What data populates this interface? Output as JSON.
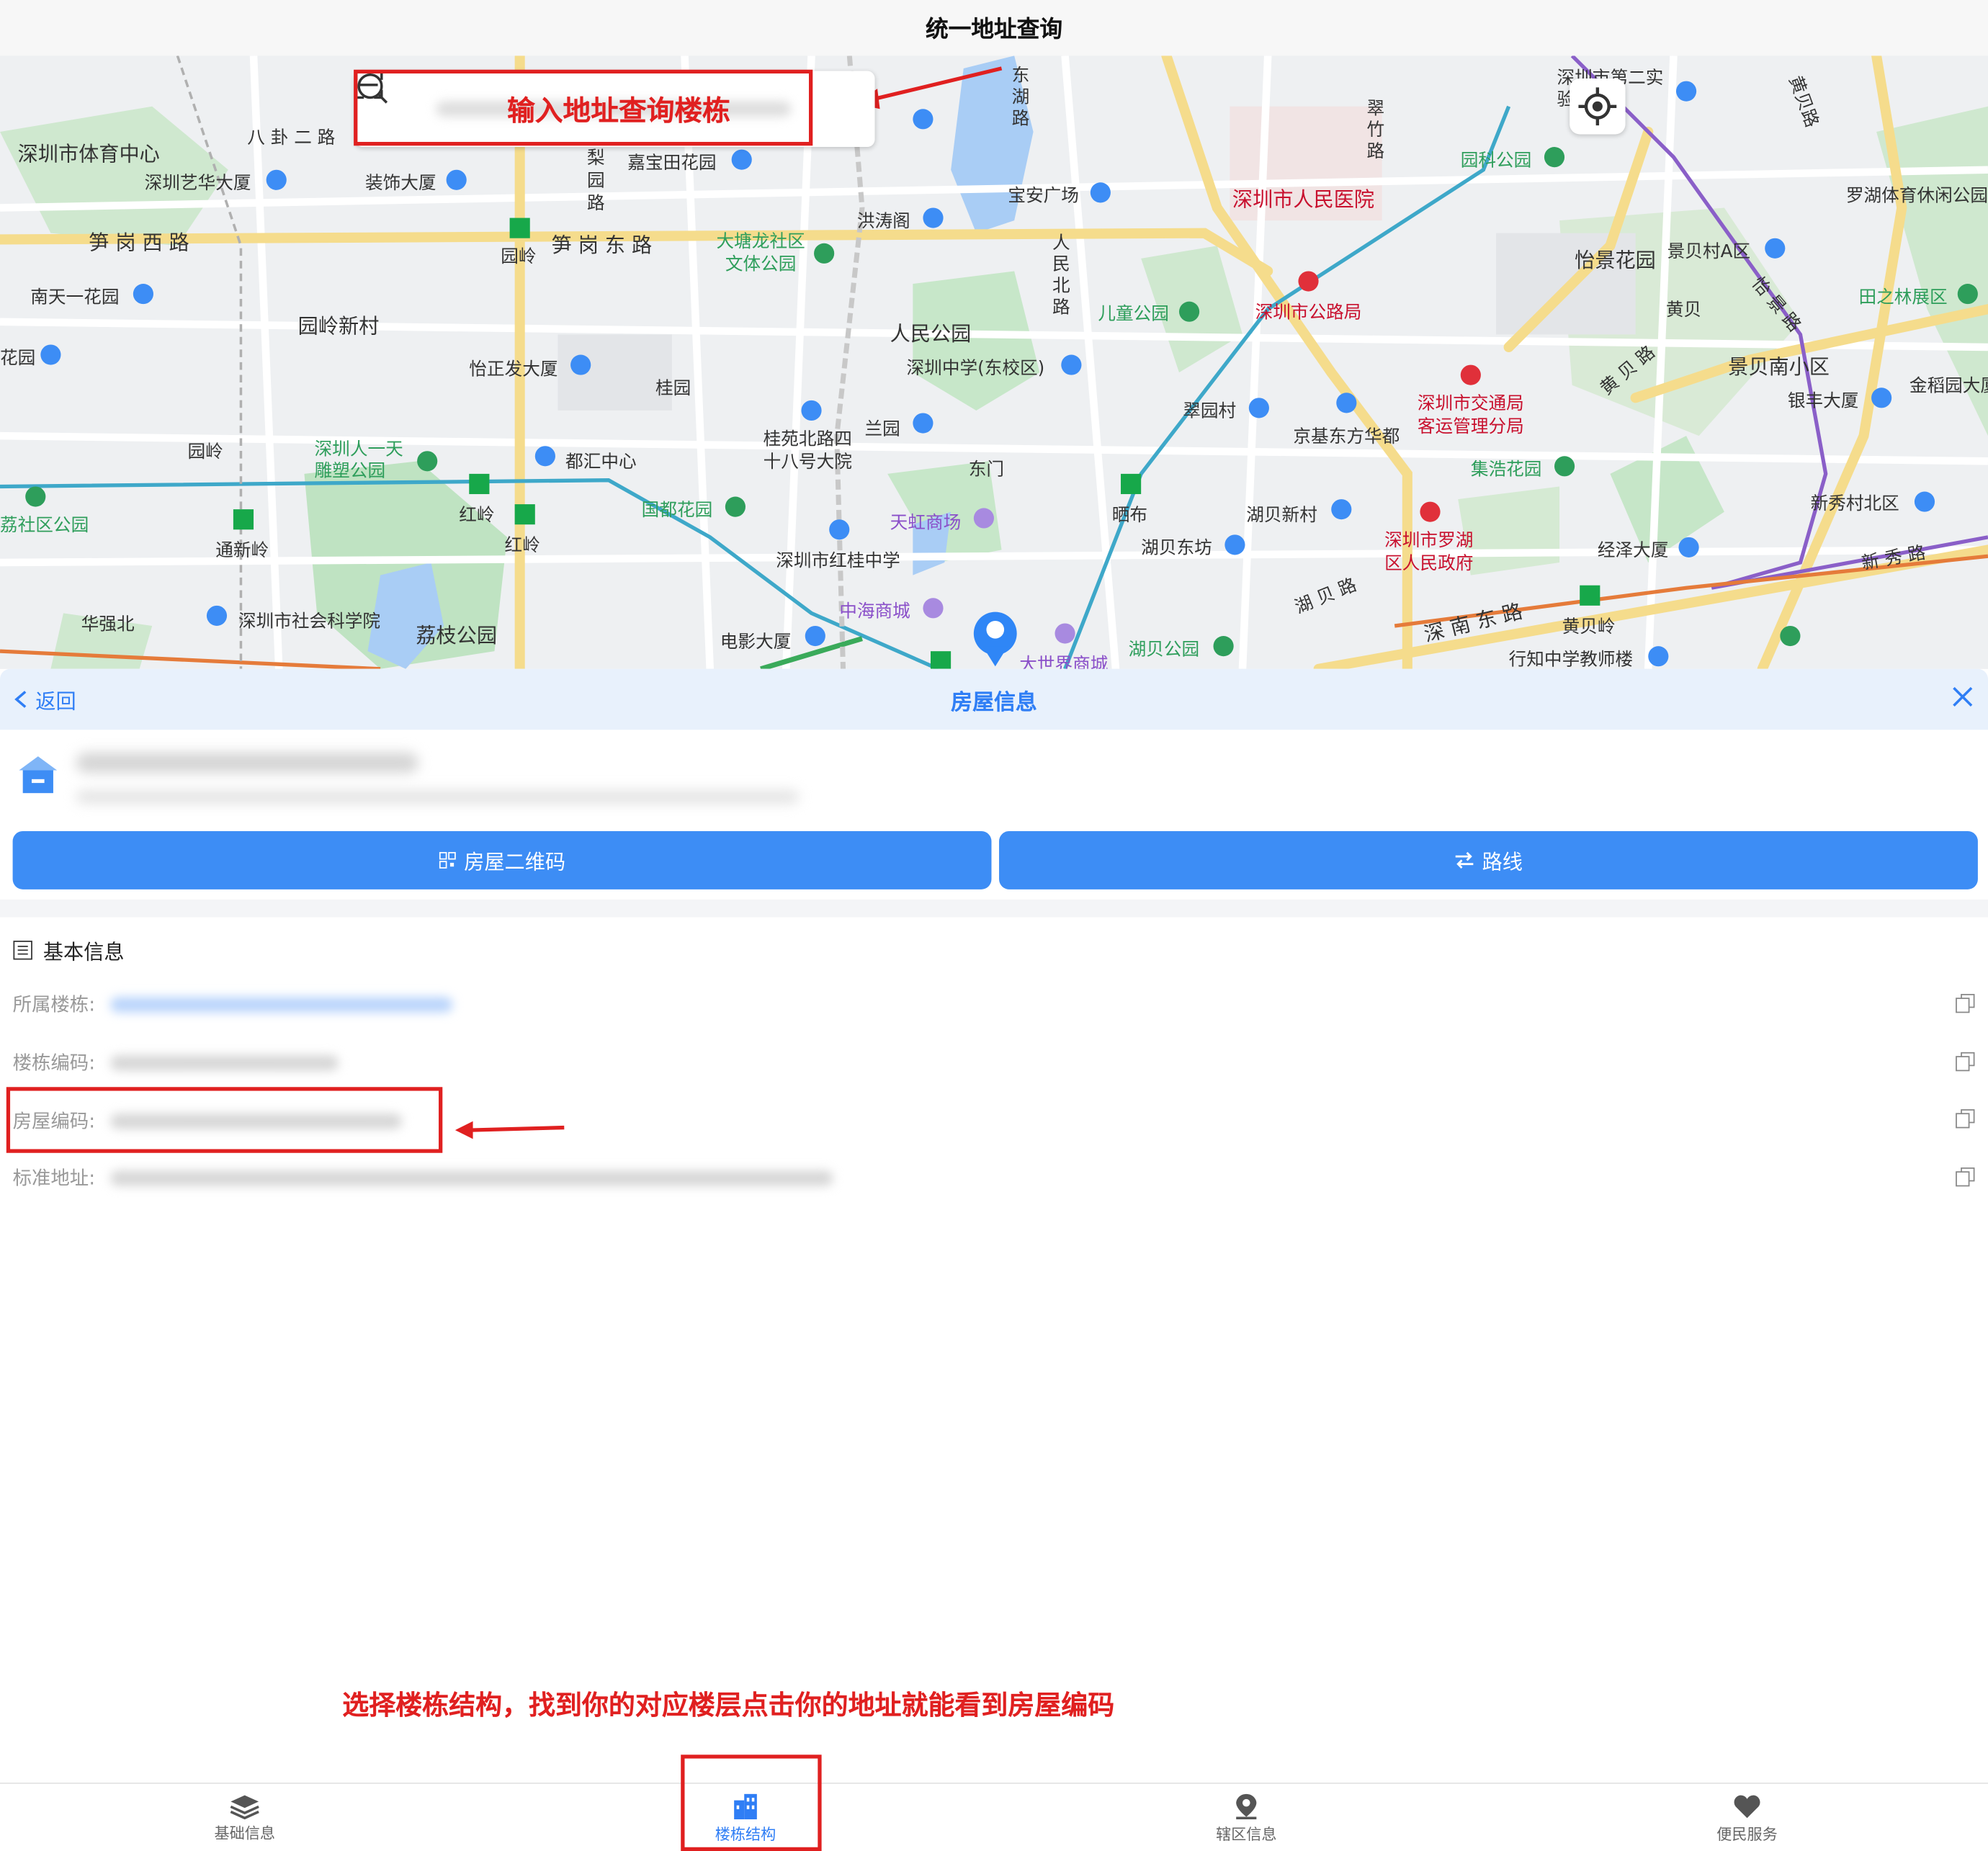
{
  "title": "统一地址查询",
  "map": {
    "search_hint": "输入地址查询楼栋",
    "labels": {
      "l1": "深圳市体育中心",
      "l2": "八 卦 二 路",
      "l3": "深圳艺华大厦",
      "l4": "装饰大厦",
      "l5": "梨园路",
      "l6": "嘉宝田花园",
      "l7": "笋 岗 西 路",
      "l8": "笋 岗 东 路",
      "l9": "园岭",
      "l10": "南天一花园",
      "l11": "园岭新村",
      "l12": "怡正发大厦",
      "l13": "桂园",
      "l14": "园岭",
      "l15": "深圳人一天雕塑公园",
      "l16": "都汇中心",
      "l17": "红岭",
      "l18": "红岭",
      "l19": "荔社区公园",
      "l20": "通新岭",
      "l21": "华强北",
      "l22": "深圳市社会科学院",
      "l23": "荔枝公园",
      "l24": "国都花园",
      "l25": "大塘龙社区文体公园",
      "l26": "洪涛阁",
      "l27": "宝安广场",
      "l28": "人民公园",
      "l29": "深圳中学(东校区)",
      "l30": "桂苑北路四十八号大院",
      "l31": "兰园",
      "l32": "东门",
      "l33": "天虹商场",
      "l34": "深圳市红桂中学",
      "l35": "中海商城",
      "l36": "电影大厦",
      "l37": "大世界商城",
      "l38": "人民北路",
      "l39": "儿童公园",
      "l40": "深圳市人民医院",
      "l41": "深圳市公路局",
      "l42": "翠竹路",
      "l43": "园科公园",
      "l44": "翠园村",
      "l45": "京基东方华都",
      "l46": "晒布",
      "l47": "湖贝新村",
      "l48": "湖贝东坊",
      "l49": "深圳市交通局客运管理分局",
      "l50": "集浩花园",
      "l51": "深圳市罗湖区人民政府",
      "l52": "湖 贝 路",
      "l53": "湖贝公园",
      "l54": "深 南 东 路",
      "l55": "黄贝岭",
      "l56": "行知中学教师楼",
      "l57": "经泽大厦",
      "l58": "怡景花园",
      "l59": "景贝村A区",
      "l60": "黄贝",
      "l61": "黄 贝 路",
      "l62": "景贝南小区",
      "l63": "银丰大厦",
      "l64": "田之林展区",
      "l65": "罗湖体育休闲公园",
      "l66": "金稻园大厦",
      "l67": "新秀村北区",
      "l68": "新 秀 路",
      "l69": "怡 景 路",
      "l70": "黄贝路",
      "l71": "深圳市第二实验中部",
      "l72": "东湖路",
      "l73": "花园",
      "l74": "园岭"
    }
  },
  "panel": {
    "back_label": "返回",
    "title": "房屋信息",
    "qr_button": "房屋二维码",
    "route_button": "路线",
    "section_title": "基本信息",
    "fields": {
      "building": "所属楼栋",
      "building_code": "楼栋编码",
      "house_code": "房屋编码",
      "std_address": "标准地址"
    }
  },
  "annotation_bottom": "选择楼栋结构，找到你的对应楼层点击你的地址就能看到房屋编码",
  "tabs": [
    {
      "label": "基础信息"
    },
    {
      "label": "楼栋结构"
    },
    {
      "label": "辖区信息"
    },
    {
      "label": "便民服务"
    }
  ],
  "colors": {
    "accent": "#2f7ef5",
    "button": "#3d8df5",
    "annotation": "#e02020"
  }
}
